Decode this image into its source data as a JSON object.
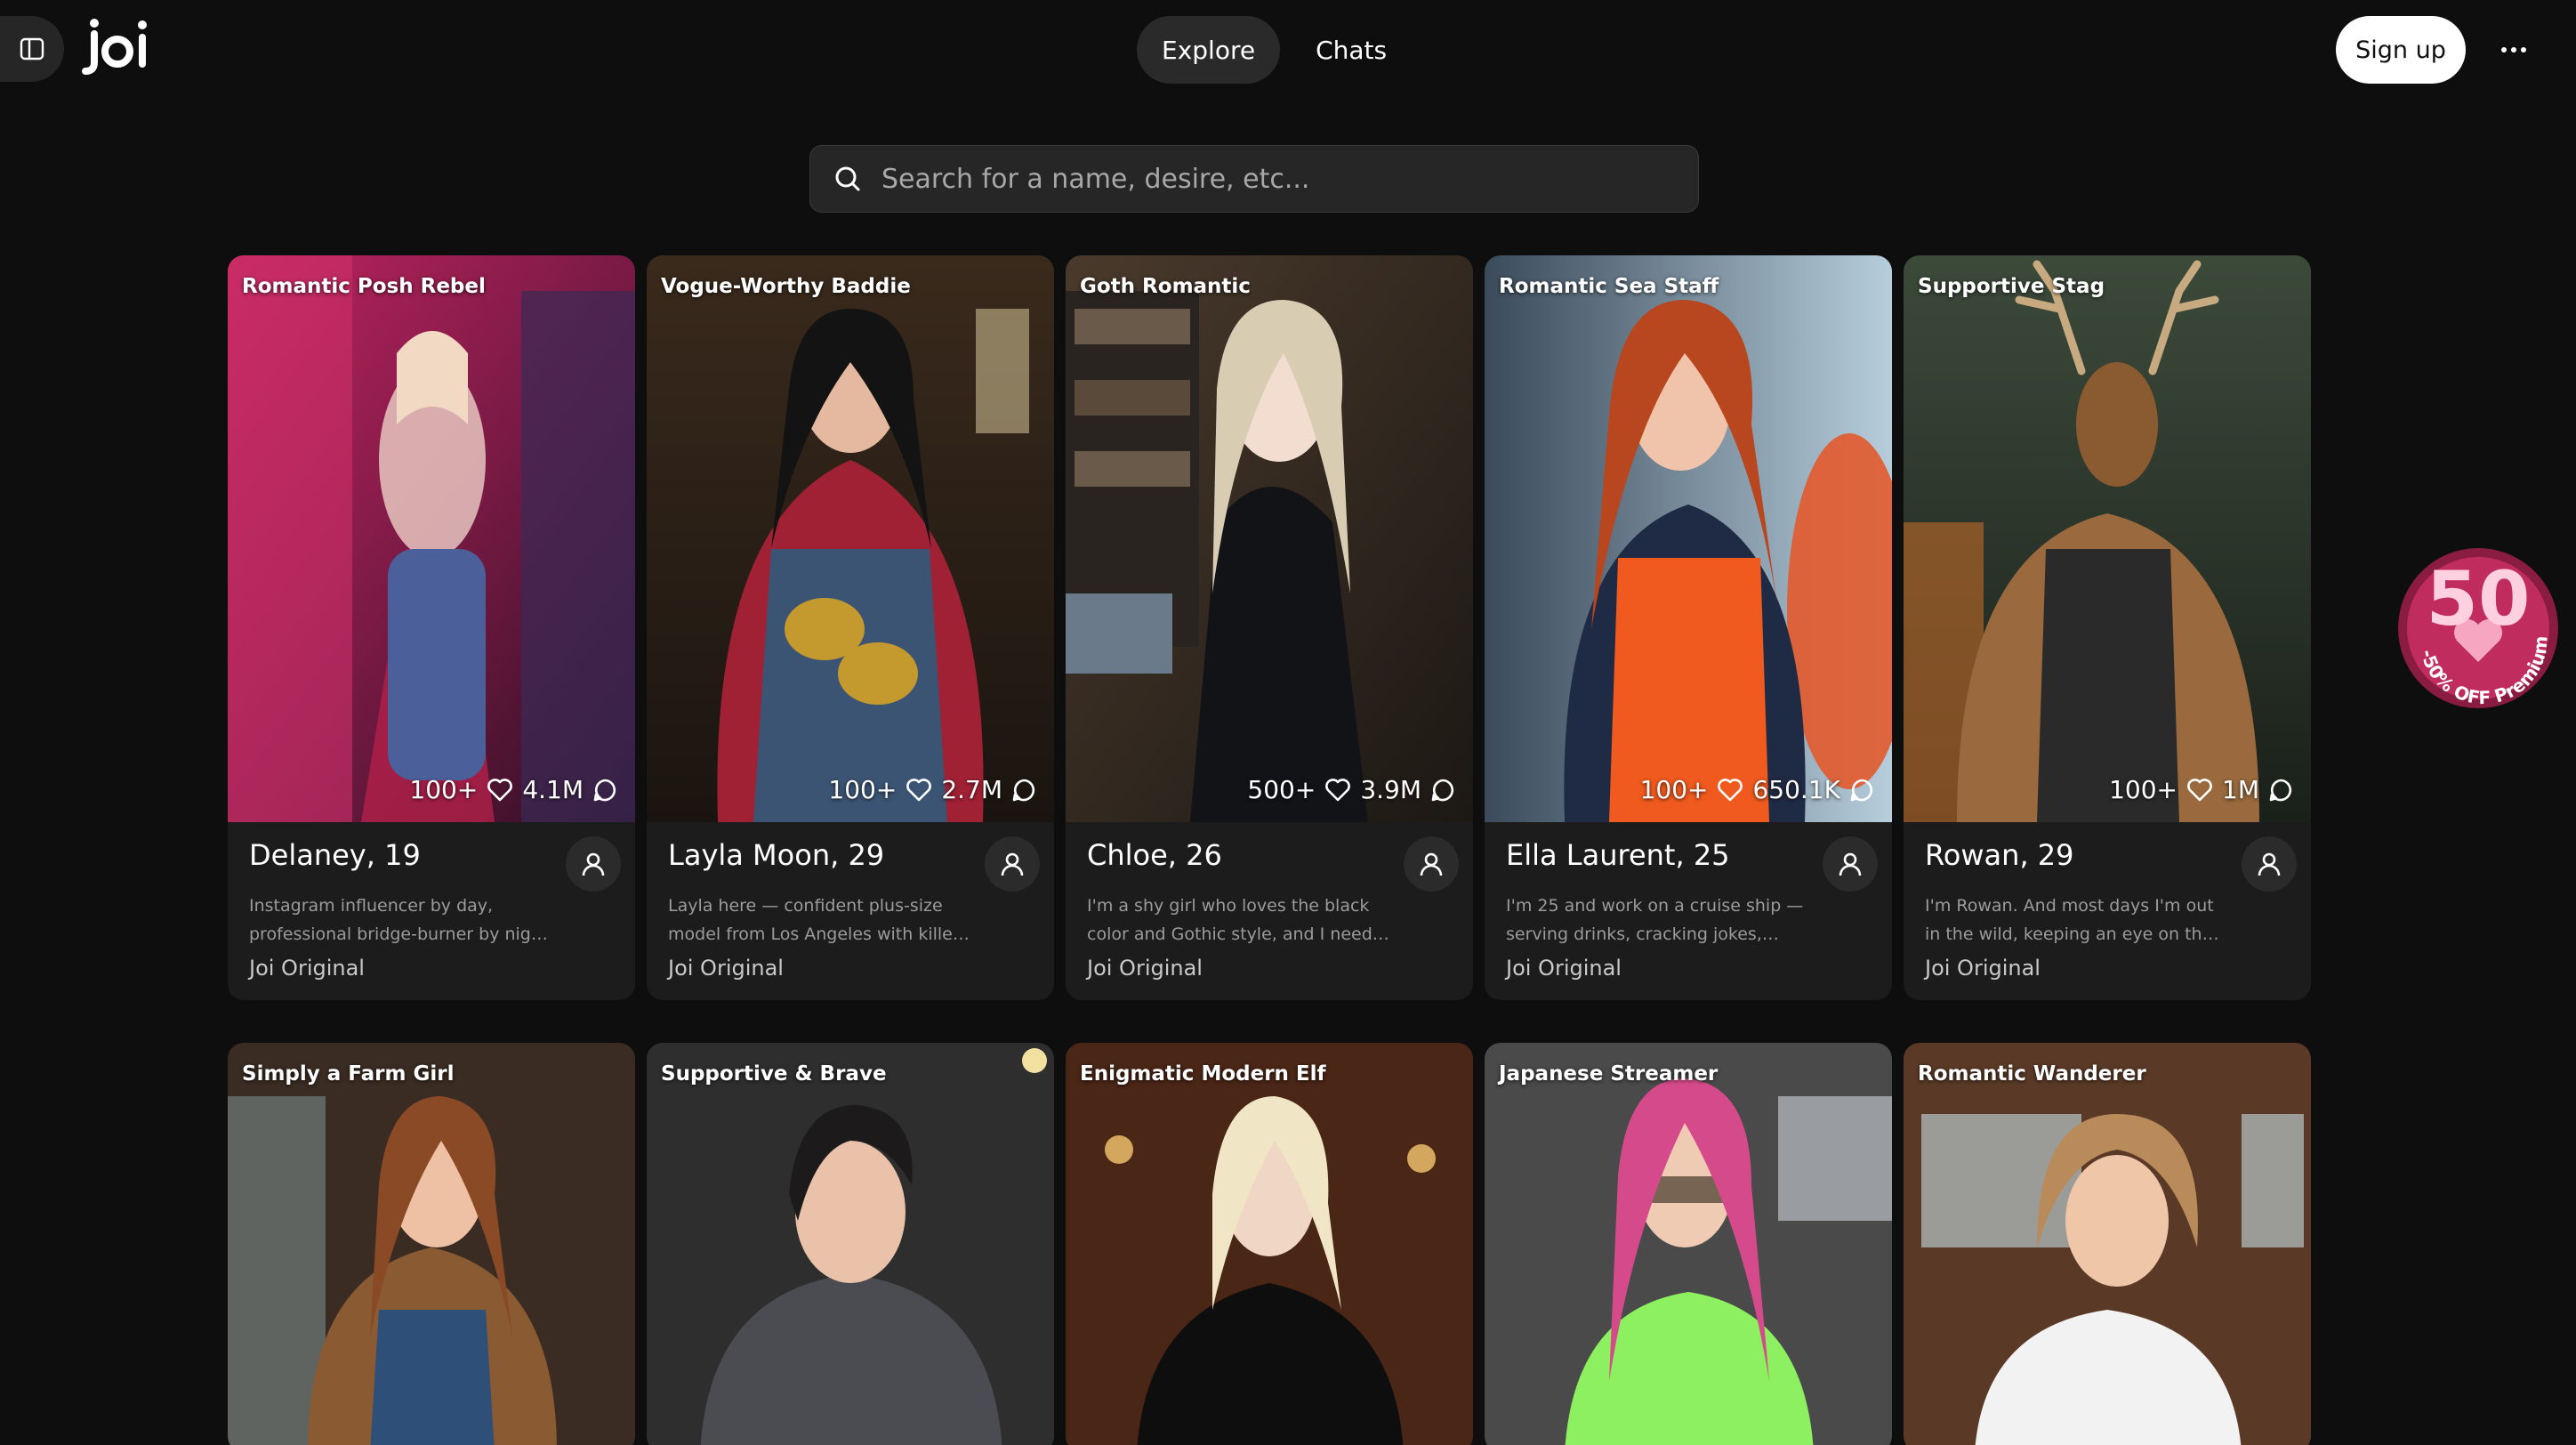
{
  "app": {
    "logo": "Joi"
  },
  "header": {
    "nav_tabs": [
      {
        "label": "Explore",
        "active": true
      },
      {
        "label": "Chats",
        "active": false
      }
    ],
    "signup_label": "Sign up",
    "more_icon": "ellipsis-icon",
    "sidebar_icon": "sidebar-toggle-icon"
  },
  "search": {
    "placeholder": "Search for a name, desire, etc...",
    "value": ""
  },
  "cards_row1": [
    {
      "tagline": "Romantic Posh Rebel",
      "likes": "100+",
      "chats": "4.1M",
      "name": "Delaney, 19",
      "description": "Instagram influencer by day, professional bridge-burner by night ...",
      "badge": "Joi Original"
    },
    {
      "tagline": "Vogue-Worthy Baddie",
      "likes": "100+",
      "chats": "2.7M",
      "name": "Layla Moon, 29",
      "description": "Layla here — confident plus-size model from Los Angeles with killer curves💅...",
      "badge": "Joi Original"
    },
    {
      "tagline": "Goth Romantic",
      "likes": "500+",
      "chats": "3.9M",
      "name": "Chloe, 26",
      "description": "I'm a shy girl who loves the black color and Gothic style, and I need someone...",
      "badge": "Joi Original"
    },
    {
      "tagline": "Romantic Sea Staff",
      "likes": "100+",
      "chats": "650.1K",
      "name": "Ella Laurent, 25",
      "description": "I'm 25 and work on a cruise ship — serving drinks, cracking jokes, and...",
      "badge": "Joi Original"
    },
    {
      "tagline": "Supportive Stag",
      "likes": "100+",
      "chats": "1M",
      "name": "Rowan, 29",
      "description": "I'm Rowan. And most days I'm out in the wild, keeping an eye on the forest,...",
      "badge": "Joi Original"
    }
  ],
  "cards_row2": [
    {
      "tagline": "Simply a Farm Girl"
    },
    {
      "tagline": "Supportive & Brave"
    },
    {
      "tagline": "Enigmatic Modern Elf"
    },
    {
      "tagline": "Japanese Streamer"
    },
    {
      "tagline": "Romantic Wanderer"
    }
  ],
  "promo": {
    "number": "50",
    "text": "-50% OFF Premium"
  },
  "colors": {
    "background": "#0e0e0e",
    "card": "#1c1c1c",
    "promo_pink": "#e0608a"
  }
}
